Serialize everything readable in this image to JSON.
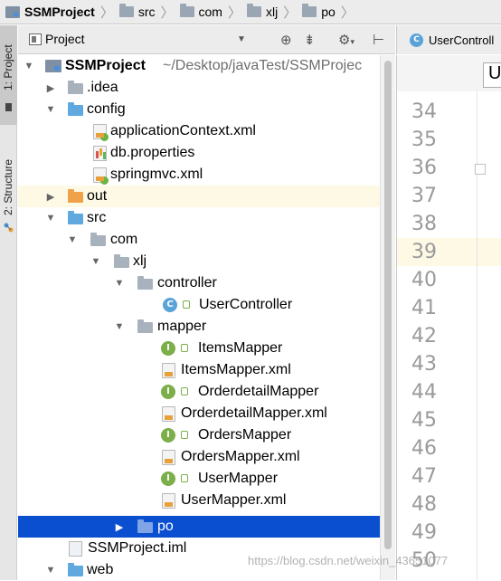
{
  "breadcrumb": {
    "items": [
      {
        "label": "SSMProject",
        "icon": "project-icon"
      },
      {
        "label": "src",
        "icon": "folder-icon"
      },
      {
        "label": "com",
        "icon": "folder-icon"
      },
      {
        "label": "xlj",
        "icon": "folder-icon"
      },
      {
        "label": "po",
        "icon": "folder-icon"
      }
    ]
  },
  "sidebar": {
    "tabs": [
      {
        "label": "1: Project",
        "active": true
      },
      {
        "label": "2: Structure",
        "active": false
      }
    ]
  },
  "project_panel": {
    "title": "Project",
    "dropdown_icon": "chevron-down-icon",
    "toolbar_icons": [
      "target-icon",
      "collapse-icon",
      "gear-icon",
      "hide-icon"
    ]
  },
  "tree": {
    "root": {
      "label": "SSMProject",
      "path": "~/Desktop/javaTest/SSMProjec"
    },
    "items": {
      "idea": ".idea",
      "config": "config",
      "appctx": "applicationContext.xml",
      "dbprops": "db.properties",
      "springmvc": "springmvc.xml",
      "out": "out",
      "src": "src",
      "com": "com",
      "xlj": "xlj",
      "controller": "controller",
      "usercontroller": "UserController",
      "mapper": "mapper",
      "itemsmapper": "ItemsMapper",
      "itemsmapperxml": "ItemsMapper.xml",
      "orderdetailmapper": "OrderdetailMapper",
      "orderdetailmapperxml": "OrderdetailMapper.xml",
      "ordersmapper": "OrdersMapper",
      "ordersmapperxml": "OrdersMapper.xml",
      "usermapper": "UserMapper",
      "usermapperxml": "UserMapper.xml",
      "po": "po",
      "iml": "SSMProject.iml",
      "web": "web"
    },
    "badges": {
      "class": "C",
      "interface": "I"
    }
  },
  "editor": {
    "tab_label": "UserControll",
    "tab_icon": "C",
    "field_text": "U",
    "line_numbers": [
      "34",
      "35",
      "36",
      "37",
      "38",
      "39",
      "40",
      "41",
      "42",
      "43",
      "44",
      "45",
      "46",
      "47",
      "48",
      "49",
      "50"
    ]
  },
  "watermark": "https://blog.csdn.net/weixin_43651077",
  "colors": {
    "selection": "#0b4fd1",
    "highlight": "#fdf9e5",
    "folder_blue": "#5fa8e0",
    "folder_orange": "#f0a24a"
  }
}
